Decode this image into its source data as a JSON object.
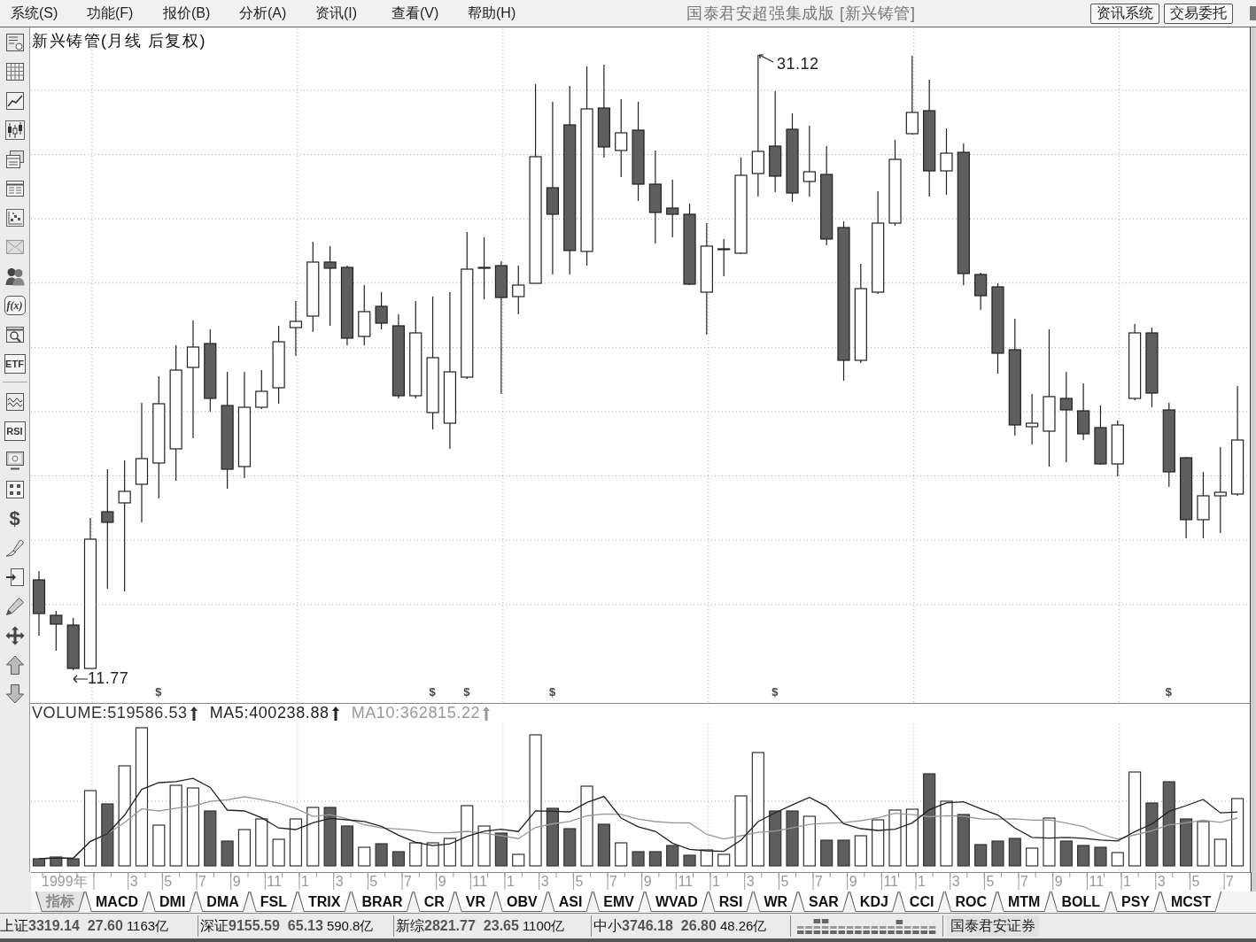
{
  "menu_bar": {
    "items": [
      "系统(S)",
      "功能(F)",
      "报价(B)",
      "分析(A)",
      "资讯(I)",
      "查看(V)",
      "帮助(H)"
    ],
    "title": "国泰君安超强集成版 [新兴铸管]",
    "buttons": [
      "资讯系统",
      "交易委托"
    ]
  },
  "left_toolbar": {
    "text_buttons": [
      "f(x)",
      "ETF",
      "RSI",
      "$"
    ]
  },
  "price_chart": {
    "title": "新兴铸管(月线 后复权)",
    "high_label": "31.12",
    "low_label": "11.77",
    "dividend_markers": [
      "$",
      "$",
      "$",
      "$",
      "$",
      "$"
    ]
  },
  "volume_chart": {
    "legend": [
      {
        "text": "VOLUME:519586.53",
        "color": "#333333"
      },
      {
        "text": "MA5:400238.88",
        "color": "#222222"
      },
      {
        "text": "MA10:362815.22",
        "color": "#999999"
      }
    ]
  },
  "time_axis": {
    "labels": [
      "1999年",
      "3",
      "5",
      "7",
      "9",
      "11",
      "1",
      "3",
      "5",
      "7",
      "9",
      "11",
      "1",
      "3",
      "5",
      "7",
      "9",
      "11",
      "1",
      "3",
      "5",
      "7",
      "9",
      "11",
      "1",
      "3",
      "5",
      "7",
      "9",
      "11",
      "1",
      "3",
      "5",
      "7"
    ]
  },
  "indicator_tabs": [
    {
      "label": "指标",
      "kind": "menu"
    },
    {
      "label": "MACD",
      "kind": "indicator"
    },
    {
      "label": "DMI",
      "kind": "indicator"
    },
    {
      "label": "DMA",
      "kind": "indicator"
    },
    {
      "label": "FSL",
      "kind": "indicator"
    },
    {
      "label": "TRIX",
      "kind": "indicator"
    },
    {
      "label": "BRAR",
      "kind": "indicator"
    },
    {
      "label": "CR",
      "kind": "indicator"
    },
    {
      "label": "VR",
      "kind": "indicator"
    },
    {
      "label": "OBV",
      "kind": "indicator"
    },
    {
      "label": "ASI",
      "kind": "indicator"
    },
    {
      "label": "EMV",
      "kind": "indicator"
    },
    {
      "label": "WVAD",
      "kind": "indicator"
    },
    {
      "label": "RSI",
      "kind": "indicator"
    },
    {
      "label": "WR",
      "kind": "indicator"
    },
    {
      "label": "SAR",
      "kind": "indicator"
    },
    {
      "label": "KDJ",
      "kind": "indicator"
    },
    {
      "label": "CCI",
      "kind": "indicator"
    },
    {
      "label": "ROC",
      "kind": "indicator"
    },
    {
      "label": "MTM",
      "kind": "indicator"
    },
    {
      "label": "BOLL",
      "kind": "indicator"
    },
    {
      "label": "PSY",
      "kind": "indicator"
    },
    {
      "label": "MCST",
      "kind": "indicator"
    }
  ],
  "status_bar": {
    "indices": [
      {
        "name": "上证",
        "value": "3319.14",
        "change": "27.60",
        "turnover": "1163亿"
      },
      {
        "name": "深证",
        "value": "9155.59",
        "change": "65.13",
        "turnover": "590.8亿"
      },
      {
        "name": "新综",
        "value": "2821.77",
        "change": "23.65",
        "turnover": "1100亿"
      },
      {
        "name": "中小",
        "value": "3746.18",
        "change": "26.80",
        "turnover": "48.26亿"
      }
    ],
    "broker": "国泰君安证券"
  }
}
